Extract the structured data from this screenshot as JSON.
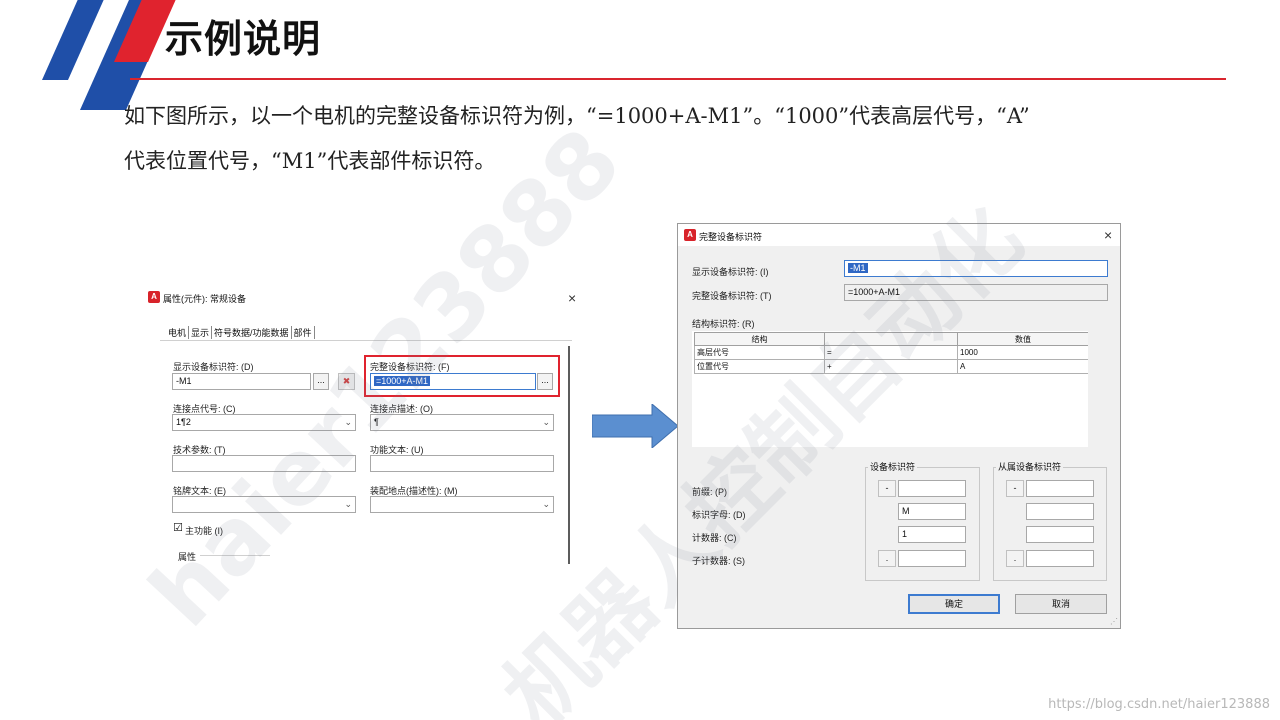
{
  "slide": {
    "title": "示例说明",
    "para1": "如下图所示，以一个电机的完整设备标识符为例，“=1000+A-M1”。“1000”代表高层代号，“A”",
    "para2": "代表位置代号，“M1”代表部件标识符。",
    "watermark_1": "haier123888",
    "watermark_2": "机器人控制自动化",
    "csdn": "https://blog.csdn.net/haier123888"
  },
  "colors": {
    "accent_red": "#e0232e",
    "accent_blue": "#1f4fa8",
    "selection_blue": "#2f67c4"
  },
  "dialog1": {
    "title": "属性(元件): 常规设备",
    "tabs": [
      "电机",
      "显示",
      "符号数据/功能数据",
      "部件"
    ],
    "display_id_label": "显示设备标识符: (D)",
    "display_id_value": "-M1",
    "full_id_label": "完整设备标识符: (F)",
    "full_id_value": "=1000+A-M1",
    "conn_code_label": "连接点代号: (C)",
    "conn_code_value": "1¶2",
    "conn_desc_label": "连接点描述: (O)",
    "conn_desc_value": "¶",
    "tech_param_label": "技术参数: (T)",
    "func_text_label": "功能文本: (U)",
    "nameplate_label": "铭牌文本: (E)",
    "mount_label": "装配地点(描述性): (M)",
    "main_func_label": "主功能 (I)",
    "main_func_checked": "☑",
    "props_label": "属性",
    "ellipsis": "...",
    "delete_icon": "✖"
  },
  "dialog2": {
    "title": "完整设备标识符",
    "display_id_label": "显示设备标识符: (I)",
    "display_id_value": "-M1",
    "full_id_label": "完整设备标识符: (T)",
    "full_id_value": "=1000+A-M1",
    "struct_label": "结构标识符: (R)",
    "columns": [
      "结构",
      "",
      "数值"
    ],
    "rows": [
      {
        "name": "高层代号",
        "sep": "=",
        "value": "1000"
      },
      {
        "name": "位置代号",
        "sep": "+",
        "value": "A"
      }
    ],
    "device_group_title": "设备标识符",
    "parent_group_title": "从属设备标识符",
    "prefix_label": "前缀: (P)",
    "letter_label": "标识字母: (D)",
    "counter_label": "计数器: (C)",
    "subcounter_label": "子计数器: (S)",
    "prefix_btn": "-",
    "letter_value": "M",
    "counter_value": "1",
    "subcounter_btn": ".",
    "parent_prefix_btn": "-",
    "parent_subcounter_btn": ".",
    "ok_label": "确定",
    "cancel_label": "取消"
  }
}
